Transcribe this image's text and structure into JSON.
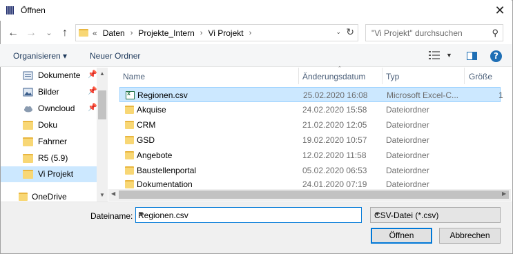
{
  "window": {
    "title": "Öffnen",
    "close_glyph": "✕"
  },
  "nav": {
    "back_glyph": "←",
    "forward_glyph": "→",
    "dropdown_glyph": "⌄",
    "up_glyph": "↑",
    "breadcrumb_overflow": "«",
    "breadcrumbs": [
      "Daten",
      "Projekte_Intern",
      "Vi Projekt"
    ],
    "separator": "›",
    "refresh_glyph": "↻",
    "search_placeholder": "\"Vi Projekt\" durchsuchen",
    "search_glyph": "⚲"
  },
  "toolbar": {
    "organize_label": "Organisieren ▾",
    "new_folder_label": "Neuer Ordner",
    "help_label": "?"
  },
  "sidebar": {
    "items": [
      {
        "label": "Dokumente",
        "icon": "documents-icon",
        "pinned": true
      },
      {
        "label": "Bilder",
        "icon": "pictures-icon",
        "pinned": true
      },
      {
        "label": "Owncloud",
        "icon": "cloud-icon",
        "pinned": true
      },
      {
        "label": "Doku",
        "icon": "folder-icon",
        "pinned": false
      },
      {
        "label": "Fahrner",
        "icon": "folder-icon",
        "pinned": false
      },
      {
        "label": "R5 (5.9)",
        "icon": "folder-icon",
        "pinned": false
      },
      {
        "label": "Vi Projekt",
        "icon": "folder-icon",
        "pinned": false,
        "selected": true
      }
    ],
    "onedrive_label": "OneDrive",
    "pin_glyph": "📌"
  },
  "columns": {
    "name": "Name",
    "date": "Änderungsdatum",
    "type": "Typ",
    "size": "Größe"
  },
  "files": [
    {
      "name": "Regionen.csv",
      "date": "25.02.2020 16:08",
      "type": "Microsoft Excel-C...",
      "size": "1",
      "icon": "excel-csv-icon",
      "selected": true
    },
    {
      "name": "Akquise",
      "date": "24.02.2020 15:58",
      "type": "Dateiordner",
      "icon": "folder-icon"
    },
    {
      "name": "CRM",
      "date": "21.02.2020 12:05",
      "type": "Dateiordner",
      "icon": "folder-icon"
    },
    {
      "name": "GSD",
      "date": "19.02.2020 10:57",
      "type": "Dateiordner",
      "icon": "folder-icon"
    },
    {
      "name": "Angebote",
      "date": "12.02.2020 11:58",
      "type": "Dateiordner",
      "icon": "folder-icon"
    },
    {
      "name": "Baustellenportal",
      "date": "05.02.2020 06:53",
      "type": "Dateiordner",
      "icon": "folder-icon"
    },
    {
      "name": "Dokumentation",
      "date": "24.01.2020 07:19",
      "type": "Dateiordner",
      "icon": "folder-icon"
    }
  ],
  "footer": {
    "filename_label": "Dateiname:",
    "filename_value": "Regionen.csv",
    "filetype_value": "CSV-Datei (*.csv)",
    "open_label": "Öffnen",
    "cancel_label": "Abbrechen"
  }
}
